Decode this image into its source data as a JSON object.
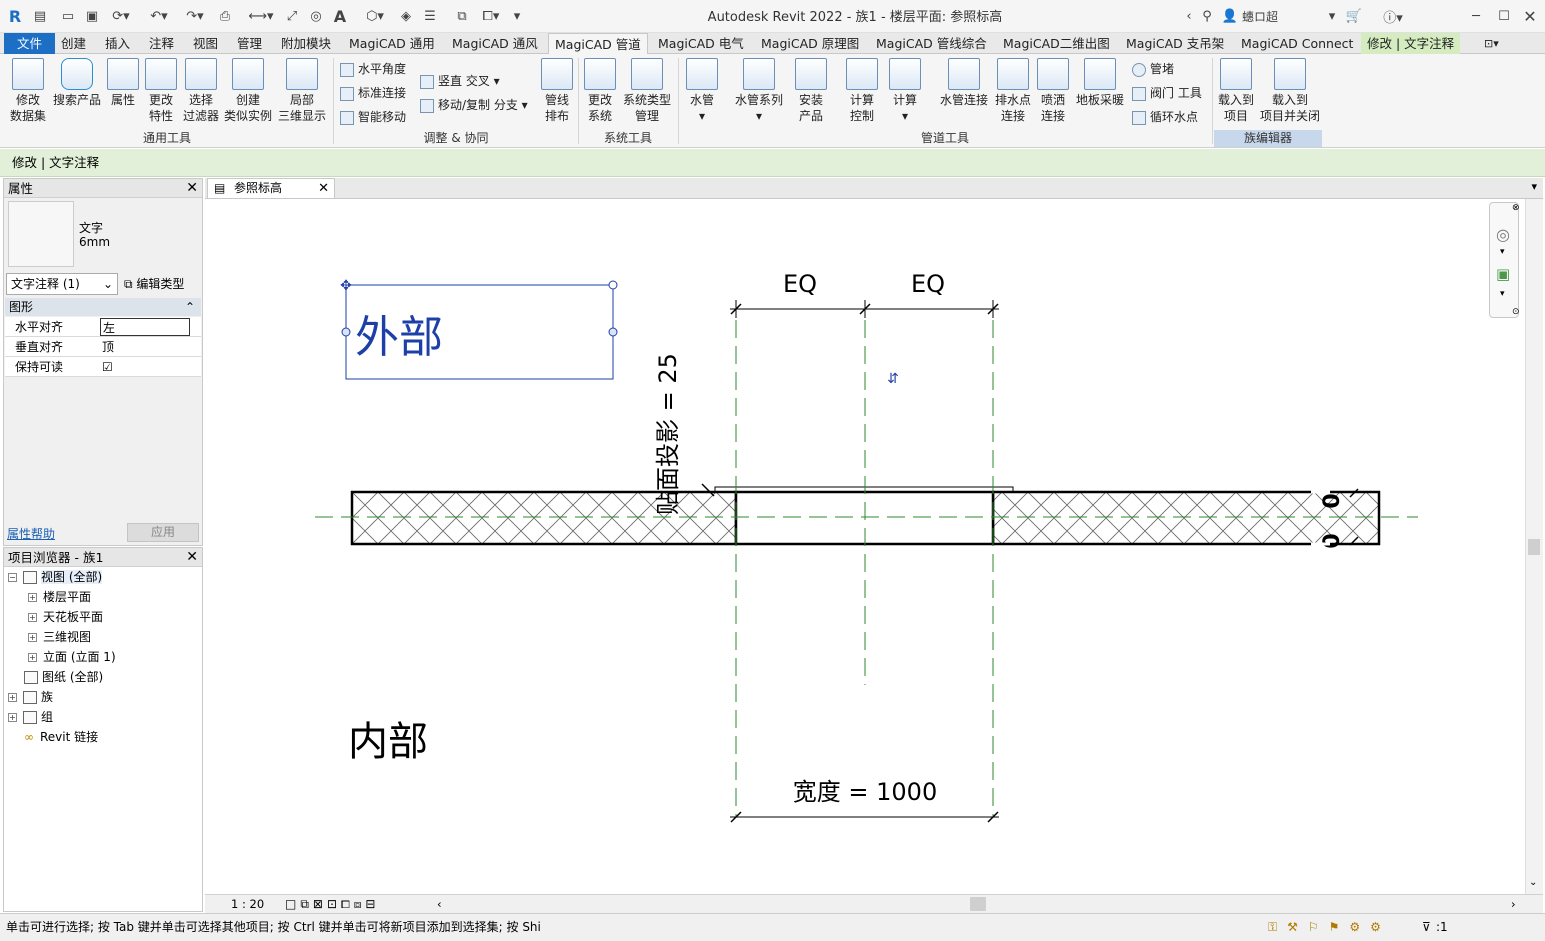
{
  "title": "Autodesk Revit 2022 - 族1 - 楼层平面: 参照标高",
  "user": "蟪ロ超",
  "tabs": [
    "文件",
    "创建",
    "插入",
    "注释",
    "视图",
    "管理",
    "附加模块",
    "MagiCAD 通用",
    "MagiCAD 通风",
    "MagiCAD 管道",
    "MagiCAD 电气",
    "MagiCAD 原理图",
    "MagiCAD 管线综合",
    "MagiCAD二维出图",
    "MagiCAD 支吊架",
    "MagiCAD Connect",
    "修改 | 文字注释"
  ],
  "ribbon": {
    "modify_dataset": "修改\n数据集",
    "search_product": "搜索产品",
    "properties": "属性",
    "change_props": "更改\n特性",
    "select_filter": "选择\n过滤器",
    "create_similar": "创建\n类似实例",
    "local_3d": "局部\n三维显示",
    "horizontal_angle": "水平角度",
    "mark_connect": "标准连接",
    "smart_move": "智能移动",
    "vertical_cross": "竖直 交叉",
    "move_copy_branch": "移动/复制 分支",
    "pipe_layout": "管线\n排布",
    "change_system": "更改\n系统",
    "systype_manage": "系统类型\n管理",
    "water_pipe": "水管",
    "pipe_series": "水管系列",
    "install_product": "安装\n产品",
    "calc_control": "计算\n控制",
    "calc": "计算",
    "pipe_connect": "水管连接",
    "drain_connect": "排水点\n连接",
    "sprinkler_connect": "喷洒\n连接",
    "floor_heating": "地板采暖",
    "casing": "管堵",
    "valve_tool": "阀门 工具",
    "circ_point": "循环水点",
    "load_project": "载入到\n项目",
    "load_close": "载入到\n项目并关闭",
    "panels": [
      "通用工具",
      "调整 & 协同",
      "系统工具",
      "管道工具",
      "族编辑器"
    ]
  },
  "context_label": "修改 | 文字注释",
  "properties": {
    "header": "属性",
    "type_name": "文字",
    "type_size": "6mm",
    "selector": "文字注释 (1)",
    "edit_type": "编辑类型",
    "group": "图形",
    "rows": [
      {
        "k": "水平对齐",
        "v": "左"
      },
      {
        "k": "垂直对齐",
        "v": "顶"
      },
      {
        "k": "保持可读",
        "v": "☑"
      }
    ],
    "help": "属性帮助",
    "apply": "应用"
  },
  "browser": {
    "header": "项目浏览器 - 族1",
    "nodes": [
      {
        "label": "视图 (全部)",
        "level": 0,
        "exp": "−"
      },
      {
        "label": "楼层平面",
        "level": 1,
        "exp": "+"
      },
      {
        "label": "天花板平面",
        "level": 1,
        "exp": "+"
      },
      {
        "label": "三维视图",
        "level": 1,
        "exp": "+"
      },
      {
        "label": "立面 (立面 1)",
        "level": 1,
        "exp": "+"
      },
      {
        "label": "图纸 (全部)",
        "level": 0,
        "exp": ""
      },
      {
        "label": "族",
        "level": 0,
        "exp": "+"
      },
      {
        "label": "组",
        "level": 0,
        "exp": "+"
      },
      {
        "label": "Revit 链接",
        "level": 0,
        "exp": ""
      }
    ]
  },
  "view_tab": "参照标高",
  "drawing": {
    "outside": "外部",
    "inside": "内部",
    "eq1": "EQ",
    "eq2": "EQ",
    "face_proj": "贴面投影 = 25",
    "width": "宽度 = 1000",
    "zero1": "0",
    "zero2": "0"
  },
  "scale": "1 : 20",
  "status": "单击可进行选择; 按 Tab 键并单击可选择其他项目; 按 Ctrl 键并单击可将新项目添加到选择集; 按 Shi",
  "filter_count": ":1"
}
